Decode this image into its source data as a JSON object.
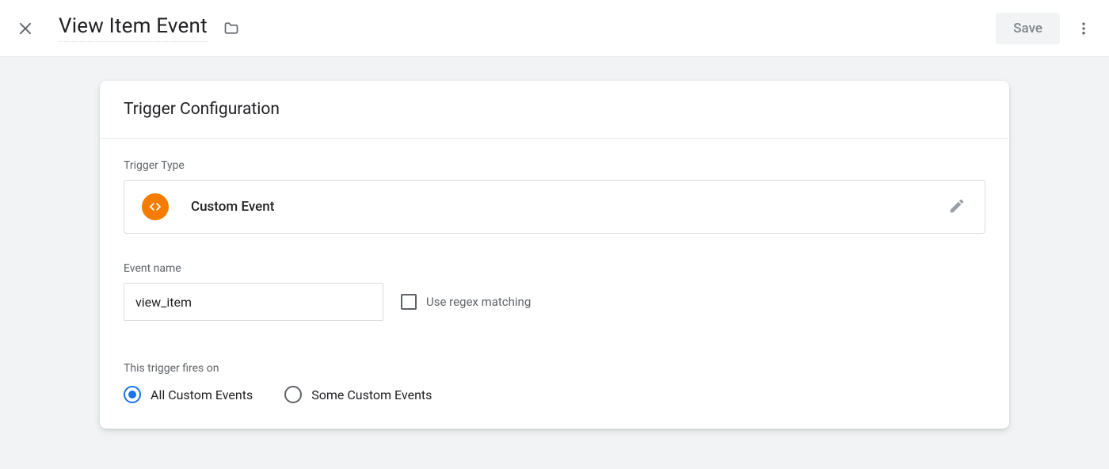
{
  "header": {
    "title": "View Item Event",
    "save_label": "Save"
  },
  "card": {
    "title": "Trigger Configuration",
    "trigger_type_label": "Trigger Type",
    "trigger_type_value": "Custom Event",
    "event_name_label": "Event name",
    "event_name_value": "view_item",
    "regex_checkbox_label": "Use regex matching",
    "regex_checked": false,
    "fires_on_label": "This trigger fires on",
    "radio_options": {
      "all": "All Custom Events",
      "some": "Some Custom Events"
    },
    "radio_selected": "all"
  },
  "icons": {
    "close": "close-icon",
    "folder": "folder-icon",
    "kebab": "kebab-menu-icon",
    "code": "code-icon",
    "pencil": "pencil-icon"
  }
}
